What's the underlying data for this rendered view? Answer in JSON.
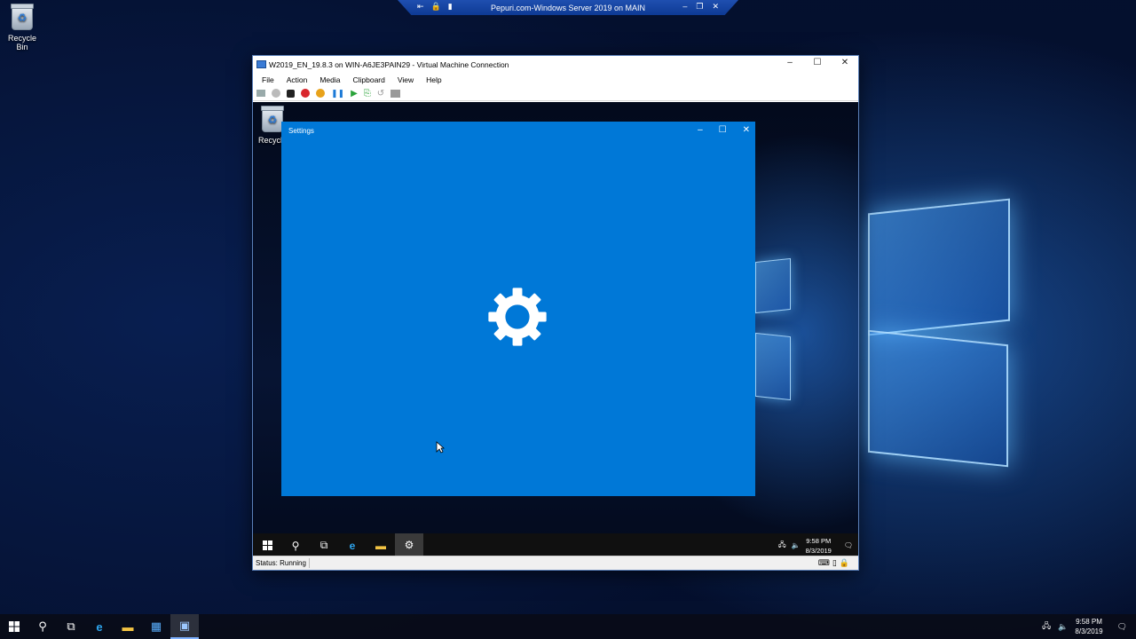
{
  "host": {
    "rdp_title": "Pepuri.com-Windows Server 2019 on MAIN",
    "desktop_icon_label": "Recycle Bin",
    "clock_time": "9:58 PM",
    "clock_date": "8/3/2019"
  },
  "vm": {
    "title": "W2019_EN_19.8.3 on WIN-A6JE3PAIN29 - Virtual Machine Connection",
    "menu": [
      "File",
      "Action",
      "Media",
      "Clipboard",
      "View",
      "Help"
    ],
    "desktop_icon_label": "Recycle",
    "settings_title": "Settings",
    "clock_time": "9:58 PM",
    "clock_date": "8/3/2019",
    "status": "Status: Running"
  },
  "colors": {
    "settings_bg": "#0078d7",
    "accent": "#3a7bd5"
  }
}
